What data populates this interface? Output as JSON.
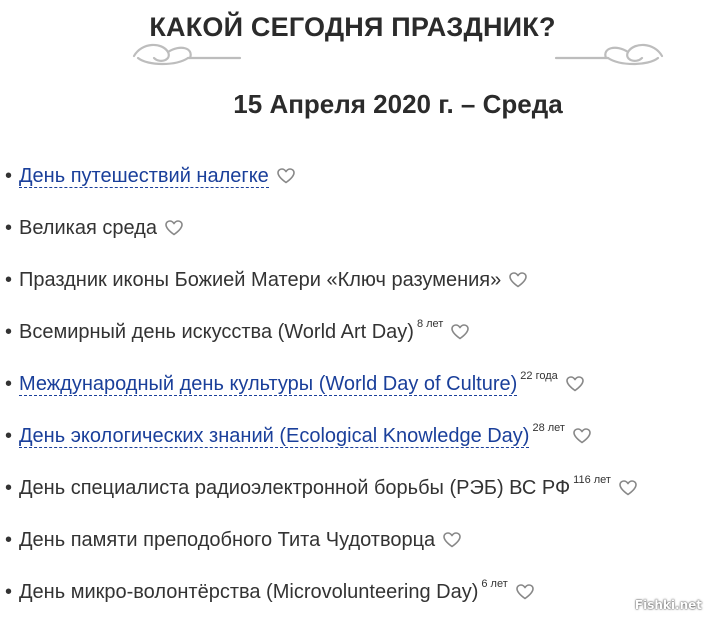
{
  "page": {
    "title": "КАКОЙ СЕГОДНЯ ПРАЗДНИК?",
    "date": "15 Апреля 2020 г. – Среда",
    "watermark": "Fishki.net"
  },
  "holidays": [
    {
      "label": "День путешествий налегке",
      "link": true,
      "age": ""
    },
    {
      "label": "Великая среда",
      "link": false,
      "age": ""
    },
    {
      "label": "Праздник иконы Божией Матери «Ключ разумения»",
      "link": false,
      "age": ""
    },
    {
      "label": "Всемирный день искусства (World Art Day)",
      "link": false,
      "age": "8 лет"
    },
    {
      "label": "Международный день культуры (World Day of Culture)",
      "link": true,
      "age": "22 года"
    },
    {
      "label": "День экологических знаний (Ecological Knowledge Day)",
      "link": true,
      "age": "28 лет"
    },
    {
      "label": "День специалиста радиоэлектронной борьбы (РЭБ) ВС РФ",
      "link": false,
      "age": "116 лет"
    },
    {
      "label": "День памяти преподобного Тита Чудотворца",
      "link": false,
      "age": ""
    },
    {
      "label": "День микро-волонтёрства (Microvolunteering Day)",
      "link": false,
      "age": "6 лет"
    }
  ],
  "icons": {
    "favorite": "heart-outline-icon",
    "ornament": "flourish-divider-icon"
  },
  "colors": {
    "link": "#1a3f9a",
    "text": "#333333",
    "ornament": "#bdbdbd",
    "heart": "#888888"
  }
}
